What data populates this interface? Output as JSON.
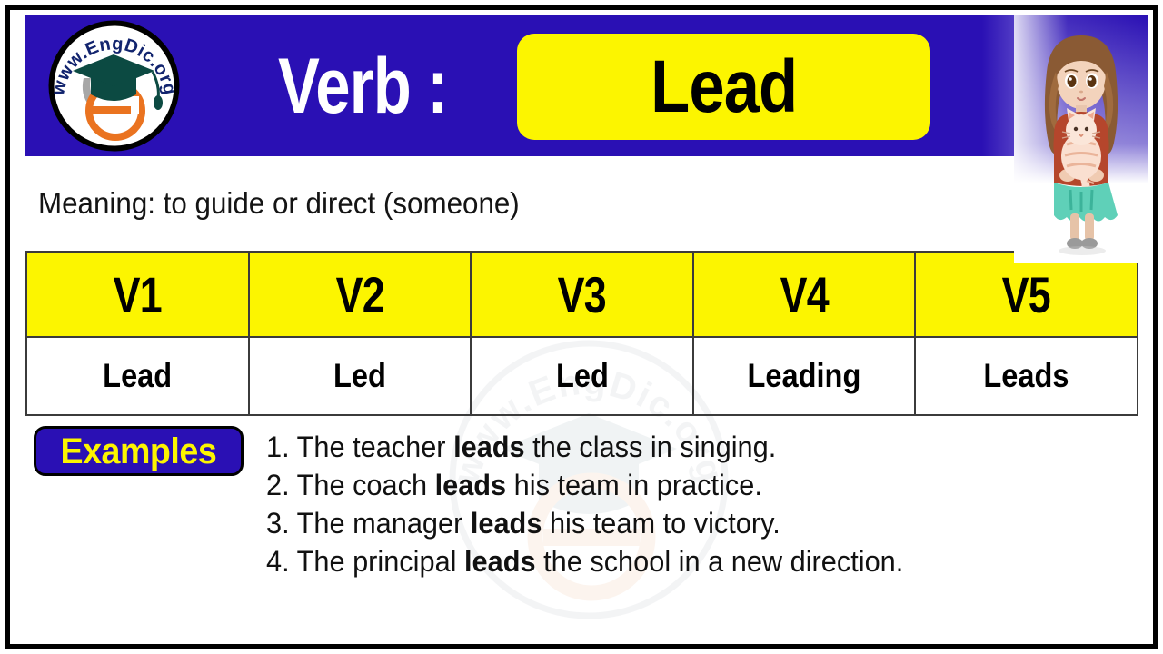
{
  "brand": {
    "logo_text": "www.EngDic.org",
    "logo_alt": "engdic-graduation-cap-e-logo",
    "watermark_text": "www.EngDic.org"
  },
  "header": {
    "label": "Verb :",
    "word": "Lead"
  },
  "illustration": {
    "alt": "girl-holding-cat-illustration"
  },
  "meaning": {
    "text": "Meaning: to guide or direct (someone)"
  },
  "table": {
    "columns": [
      "V1",
      "V2",
      "V3",
      "V4",
      "V5"
    ],
    "forms": [
      "Lead",
      "Led",
      "Led",
      "Leading",
      "Leads"
    ]
  },
  "examples": {
    "badge_label": "Examples",
    "items": [
      {
        "number": "1.",
        "before": " The teacher ",
        "bold": "leads",
        "after": " the class in singing."
      },
      {
        "number": "2.",
        "before": " The coach ",
        "bold": "leads",
        "after": " his team in practice."
      },
      {
        "number": "3.",
        "before": " The manager ",
        "bold": "leads",
        "after": " his team to victory."
      },
      {
        "number": "4.",
        "before": " The principal ",
        "bold": "leads",
        "after": " the school in a new direction."
      }
    ]
  },
  "colors": {
    "brand_blue": "#2a10b4",
    "accent_yellow": "#fcf500",
    "frame_black": "#000000",
    "grid_gray": "#3b3b3b"
  }
}
